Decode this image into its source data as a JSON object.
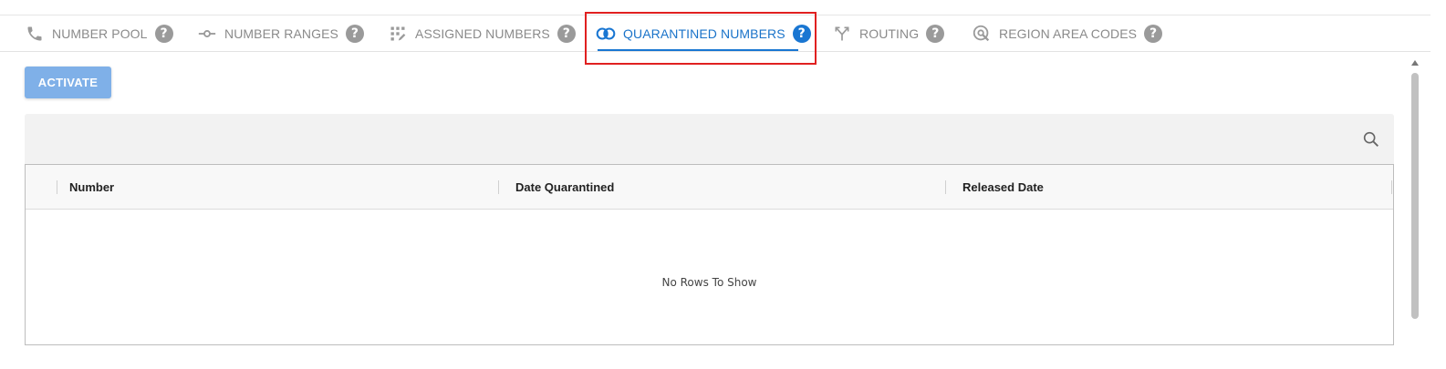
{
  "tabs": [
    {
      "label": "NUMBER POOL",
      "icon": "phone-icon"
    },
    {
      "label": "NUMBER RANGES",
      "icon": "range-icon"
    },
    {
      "label": "ASSIGNED NUMBERS",
      "icon": "assigned-grid-icon"
    },
    {
      "label": "QUARANTINED NUMBERS",
      "icon": "quarantine-icon",
      "active": true
    },
    {
      "label": "ROUTING",
      "icon": "routing-icon"
    },
    {
      "label": "REGION AREA CODES",
      "icon": "region-search-icon"
    }
  ],
  "help_glyph": "?",
  "actions": {
    "activate_label": "ACTIVATE"
  },
  "grid": {
    "columns": [
      "Number",
      "Date Quarantined",
      "Released Date"
    ],
    "empty_message": "No Rows To Show"
  },
  "colors": {
    "accent": "#1976d2",
    "button": "#7fb0e8",
    "highlight": "#e02020",
    "inactive_tab": "#8a8a8a"
  }
}
